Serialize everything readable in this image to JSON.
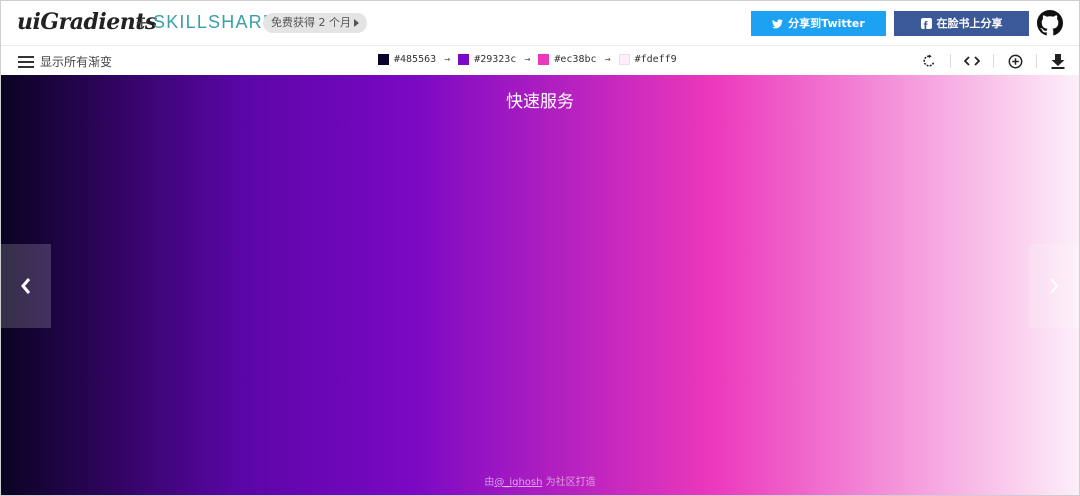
{
  "header": {
    "logo_text": "uiGradients",
    "plus": "+",
    "partner": "SKILLSHARE",
    "promo": "免费获得 2 个月",
    "share_twitter": "分享到Twitter",
    "share_facebook": "在脸书上分享",
    "icons": [
      "twitter-icon",
      "facebook-icon",
      "github-icon"
    ]
  },
  "toolbar": {
    "show_all": "显示所有渐变",
    "stops": [
      {
        "hex": "#485563",
        "color": "#0b0428"
      },
      {
        "hex": "#29323c",
        "color": "#7a08c4"
      },
      {
        "hex": "#ec38bc",
        "color": "#ec38bc"
      },
      {
        "hex": "#fdeff9",
        "color": "#fdeff9"
      }
    ],
    "arrow": "→",
    "tools": [
      "rotate-icon",
      "code-icon",
      "add-circle-icon",
      "download-icon"
    ]
  },
  "gradient": {
    "name": "快速服务",
    "colors": [
      "#0a0322",
      "#5a06a6",
      "#7a08c4",
      "#ec38bc",
      "#fdeff9"
    ]
  },
  "footer": {
    "credit_prefix": "由",
    "credit_link": "@_ighosh",
    "credit_suffix": " 为社区打造"
  }
}
